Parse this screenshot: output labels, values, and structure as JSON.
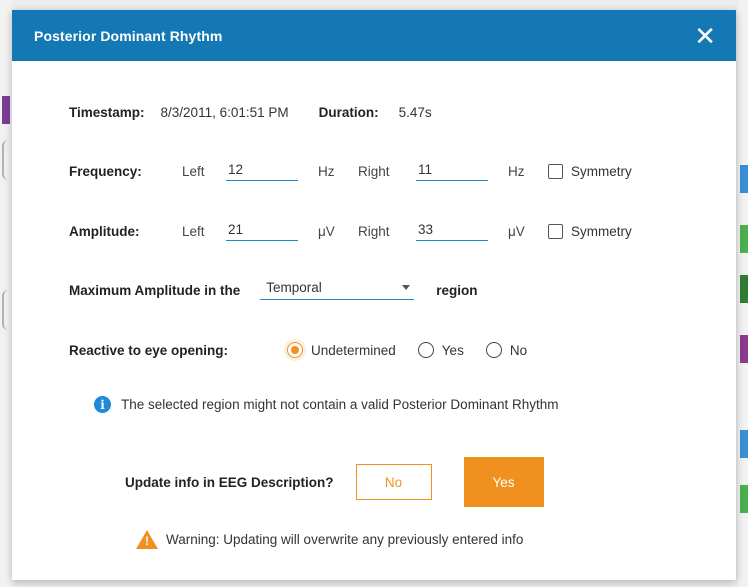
{
  "dialog": {
    "title": "Posterior Dominant Rhythm",
    "close_glyph": "✕"
  },
  "timestamp": {
    "label": "Timestamp:",
    "value": "8/3/2011, 6:01:51 PM"
  },
  "duration": {
    "label": "Duration:",
    "value": "5.47s"
  },
  "frequency": {
    "label": "Frequency:",
    "left_label": "Left",
    "left_value": "12",
    "left_unit": "Hz",
    "right_label": "Right",
    "right_value": "11",
    "right_unit": "Hz",
    "symmetry_label": "Symmetry"
  },
  "amplitude": {
    "label": "Amplitude:",
    "left_label": "Left",
    "left_value": "21",
    "left_unit": "μV",
    "right_label": "Right",
    "right_value": "33",
    "right_unit": "μV",
    "symmetry_label": "Symmetry"
  },
  "max_amplitude": {
    "prefix": "Maximum Amplitude in the",
    "selected": "Temporal",
    "suffix": "region"
  },
  "reactive": {
    "label": "Reactive to eye opening:",
    "options": [
      "Undetermined",
      "Yes",
      "No"
    ],
    "selected": "Undetermined"
  },
  "info_message": "The selected region might not contain a valid Posterior Dominant Rhythm",
  "update": {
    "question": "Update info in EEG Description?",
    "no_label": "No",
    "yes_label": "Yes"
  },
  "warning": "Warning: Updating will overwrite any previously entered info",
  "colors": {
    "accent_blue": "#1378b3",
    "orange": "#f0901f",
    "link_blue": "#1f8ac8"
  },
  "icons": {
    "info": "info-icon",
    "warning": "warning-icon",
    "close": "close-icon"
  }
}
